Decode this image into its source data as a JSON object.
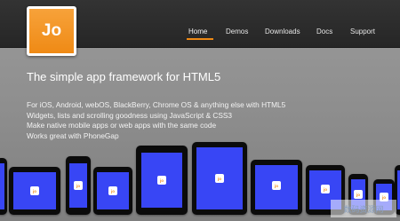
{
  "logo": {
    "text": "Jo"
  },
  "nav": {
    "items": [
      {
        "label": "Home",
        "active": true
      },
      {
        "label": "Demos",
        "active": false
      },
      {
        "label": "Downloads",
        "active": false
      },
      {
        "label": "Docs",
        "active": false
      },
      {
        "label": "Support",
        "active": false
      }
    ]
  },
  "hero": {
    "headline": "The simple app framework for HTML5",
    "features": [
      "For iOS, Android, webOS, BlackBerry, Chrome OS & anything else with HTML5",
      "Widgets, lists and scrolling goodness using JavaScript & CSS3",
      "Make native mobile apps or web apps with the same code",
      "Works great with PhoneGap"
    ]
  },
  "device_icon_text": "jo",
  "watermark": {
    "text": "数码资源网"
  },
  "colors": {
    "accent": "#ef8a15",
    "screen": "#3846f5",
    "topbar": "#2b2b2b",
    "background": "#8f8f8f"
  }
}
